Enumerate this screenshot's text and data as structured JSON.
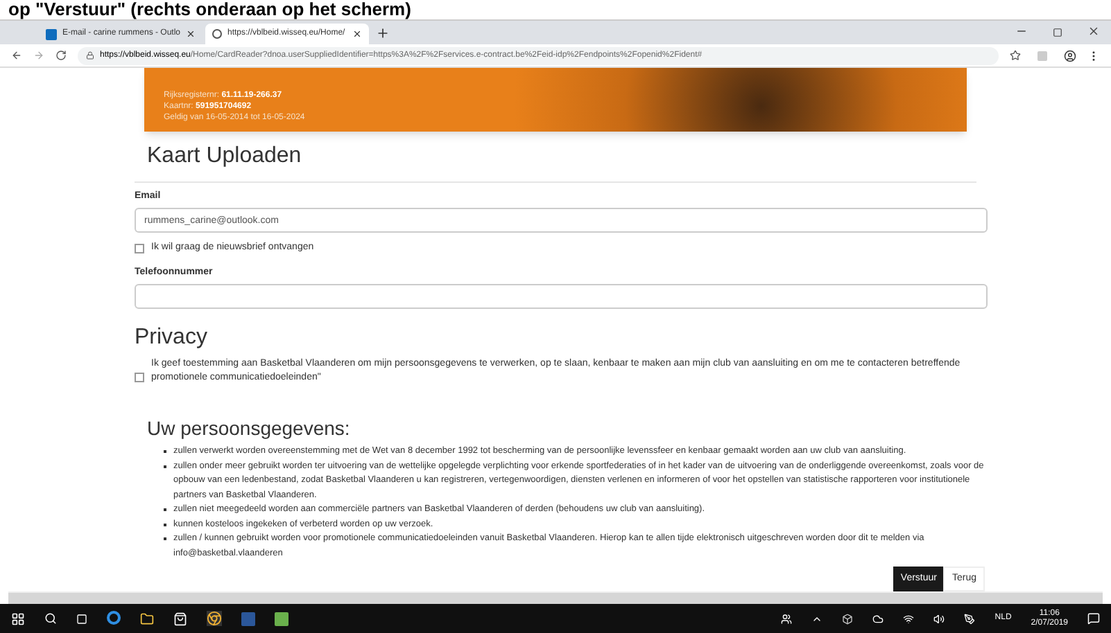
{
  "caption": "op \"Verstuur\" (rechts onderaan op het scherm)",
  "browser": {
    "tabs": [
      {
        "title": "E-mail - carine rummens - Outlo",
        "selected": false
      },
      {
        "title": "https://vblbeid.wisseq.eu/Home/",
        "selected": true
      }
    ],
    "url_host": "https://vblbeid.wisseq.eu",
    "url_path": "/Home/CardReader?dnoa.userSuppliedIdentifier=https%3A%2F%2Fservices.e-contract.be%2Feid-idp%2Fendpoints%2Fopenid%2Fident#"
  },
  "card": {
    "lines": [
      {
        "label": "Rijksregisternr:",
        "value": "61.11.19-266.37"
      },
      {
        "label": "Kaartnr:",
        "value": "591951704692"
      },
      {
        "label": "Geldig van 16-05-2014 tot 16-05-2024"
      }
    ]
  },
  "title": "Kaart Uploaden",
  "email": {
    "label": "Email",
    "value": "rummens_carine@outlook.com"
  },
  "newsletter": {
    "label": "Ik wil graag de nieuwsbrief ontvangen",
    "checked": false
  },
  "phone": {
    "label": "Telefoonnummer"
  },
  "privacy": {
    "heading": "Privacy",
    "consent": {
      "label": "Ik geef toestemming aan Basketbal Vlaanderen om mijn persoonsgegevens te verwerken, op te slaan, kenbaar te maken aan mijn club van aansluiting en om me te contacteren betreffende promotionele communicatiedoeleinden\"",
      "checked": false
    }
  },
  "personal_data": {
    "heading": "Uw persoonsgegevens:",
    "items": [
      "zullen verwerkt worden overeenstemming met de Wet van 8 december 1992 tot bescherming van de persoonlijke levenssfeer en kenbaar gemaakt worden aan uw club van aansluiting.",
      "zullen onder meer gebruikt worden ter uitvoering van de wettelijke opgelegde verplichting voor erkende sportfederaties of in het kader van de uitvoering van de onderliggende overeenkomst, zoals voor de opbouw van een ledenbestand, zodat Basketbal Vlaanderen u kan registreren, vertegenwoordigen, diensten verlenen en informeren of voor het opstellen van statistische rapporteren voor institutionele partners van Basketbal Vlaanderen.",
      "zullen niet meegedeeld worden aan commerciële partners van Basketbal Vlaanderen of derden (behoudens uw club van aansluiting).",
      "kunnen kosteloos ingekeken of verbeterd worden op uw verzoek.",
      "zullen / kunnen gebruikt worden voor promotionele communicatiedoeleinden vanuit Basketbal Vlaanderen. Hierop kan te allen tijde elektronisch uitgeschreven worden door dit te melden via info@basketbal.vlaanderen"
    ]
  },
  "buttons": [
    {
      "label": "Verstuur",
      "kind": "primary"
    },
    {
      "label": "Terug",
      "kind": "secondary"
    }
  ],
  "taskbar": {
    "language": "NLD",
    "time": "11:06",
    "date": "2/07/2019"
  }
}
